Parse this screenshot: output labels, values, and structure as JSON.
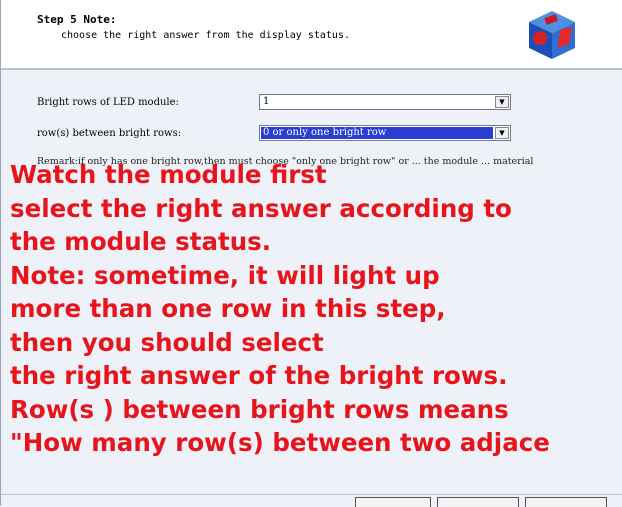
{
  "header": {
    "step_title": "Step 5 Note:",
    "step_desc": "choose the right answer from the display status."
  },
  "form": {
    "bright_rows_label": "Bright rows of LED module:",
    "bright_rows_value": "1",
    "between_rows_label": "row(s) between bright rows:",
    "between_rows_value": "0 or only one bright row",
    "remark": "Remark:if only has one bright row,then must choose \"only one bright row\" or ... the module ... material"
  },
  "overlay": {
    "lines": [
      "Watch the module first",
      "select the right answer according to",
      "the module status.",
      "Note: sometime, it will light up",
      "more than one row in this step,",
      "then you should select",
      "the right answer of the bright rows.",
      "Row(s ) between bright rows means",
      "\"How many row(s) between two  adjace"
    ]
  },
  "colors": {
    "overlay_text": "#e8141c",
    "selection": "#2a3fcf",
    "panel_bg": "#eef2f8"
  },
  "icons": {
    "logo": "cube-logo-icon",
    "dropdown": "dropdown-arrow-icon"
  }
}
